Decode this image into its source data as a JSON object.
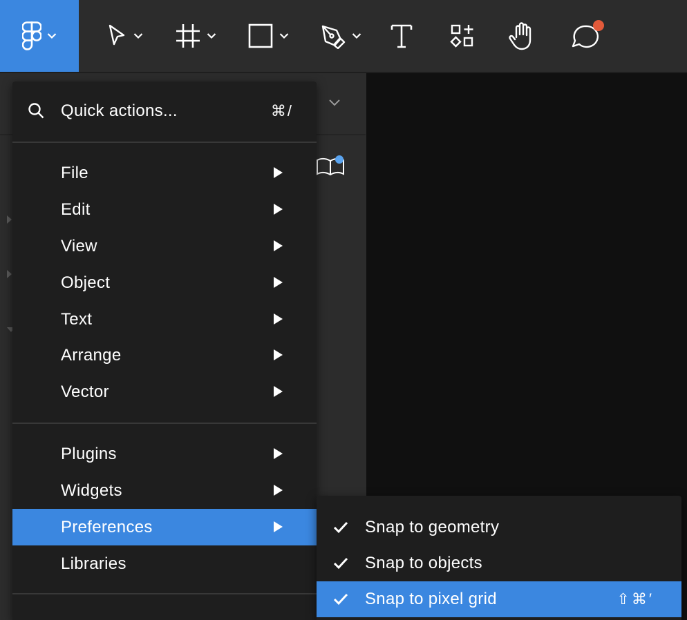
{
  "toolbar": {
    "tools": [
      "main-menu",
      "move",
      "frame",
      "shape",
      "pen",
      "text",
      "resources",
      "hand",
      "comments"
    ],
    "accent_color": "#3b87e0",
    "notification_dot_color": "#e35a3a"
  },
  "main_menu": {
    "quick_actions": {
      "label": "Quick actions...",
      "shortcut": "⌘/"
    },
    "group1": [
      {
        "label": "File"
      },
      {
        "label": "Edit"
      },
      {
        "label": "View"
      },
      {
        "label": "Object"
      },
      {
        "label": "Text"
      },
      {
        "label": "Arrange"
      },
      {
        "label": "Vector"
      }
    ],
    "group2": [
      {
        "label": "Plugins"
      },
      {
        "label": "Widgets"
      },
      {
        "label": "Preferences"
      },
      {
        "label": "Libraries"
      }
    ],
    "active_item": "Preferences"
  },
  "preferences_submenu": {
    "items": [
      {
        "label": "Snap to geometry",
        "checked": true,
        "shortcut": ""
      },
      {
        "label": "Snap to objects",
        "checked": true,
        "shortcut": ""
      },
      {
        "label": "Snap to pixel grid",
        "checked": true,
        "shortcut": "⇧⌘′"
      }
    ]
  }
}
